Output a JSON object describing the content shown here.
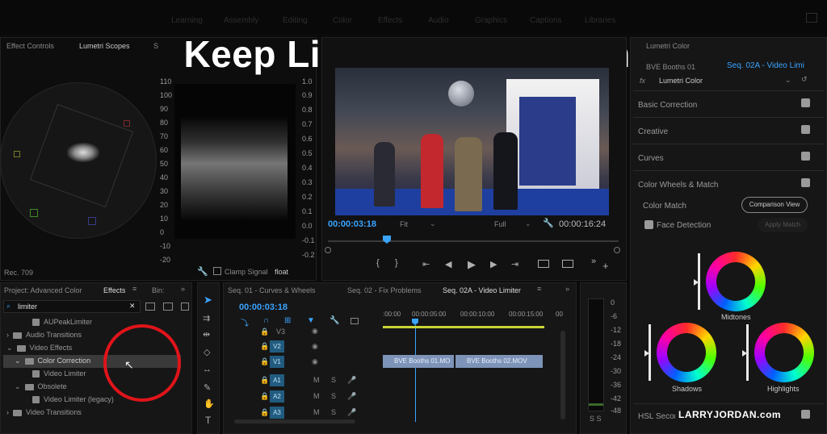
{
  "title": "Keep Lighting Consistent",
  "workspaces": [
    "Learning",
    "Assembly",
    "Editing",
    "Color",
    "Effects",
    "Audio",
    "Graphics",
    "Captions",
    "Libraries"
  ],
  "scopes": {
    "tabs": [
      "Effect Controls",
      "Lumetri Scopes",
      "S"
    ],
    "left_ticks": [
      "110",
      "100",
      "90",
      "80",
      "70",
      "60",
      "50",
      "40",
      "30",
      "20",
      "10",
      "0",
      "-10",
      "-20"
    ],
    "right_ticks": [
      "1.0",
      "0.9",
      "0.8",
      "0.7",
      "0.6",
      "0.5",
      "0.4",
      "0.3",
      "0.2",
      "0.1",
      "0.0",
      "-0.1",
      "-0.2"
    ],
    "rec": "Rec. 709",
    "clamp": "Clamp Signal",
    "float": "float"
  },
  "program": {
    "timecode": "00:00:03:18",
    "fit": "Fit",
    "full": "Full",
    "duration": "00:00:16:24"
  },
  "project": {
    "title": "Project: Advanced Color",
    "effects_tab": "Effects",
    "bin_tab": "Bin:",
    "search": "limiter",
    "items": [
      "AUPeakLimiter",
      "Audio Transitions",
      "Video Effects",
      "Color Correction",
      "Video Limiter",
      "Obsolete",
      "Video Limiter (legacy)",
      "Video Transitions"
    ]
  },
  "sequences": {
    "tabs": [
      "Seq. 01 - Curves & Wheels",
      "Seq. 02 - Fix Problems",
      "Seq. 02A - Video Limiter"
    ],
    "timecode": "00:00:03:18",
    "ruler": [
      ":00:00",
      "00:00:05:00",
      "00:00:10:00",
      "00:00:15:00",
      "00"
    ],
    "video_tracks": [
      "V3",
      "V2",
      "V1"
    ],
    "audio_tracks": [
      "A1",
      "A2",
      "A3"
    ],
    "clips": [
      "BVE Booths 01.MO",
      "BVE Booths 02.MOV"
    ]
  },
  "meter": {
    "ticks": [
      "0",
      "-6",
      "-12",
      "-18",
      "-24",
      "-30",
      "-36",
      "-42",
      "-48"
    ],
    "footer": "S S"
  },
  "lumetri": {
    "header": "Lumetri Color",
    "seq": "Seq. 02A - Video Limi",
    "clip": "BVE Booths 01",
    "fx": "Lumetri Color",
    "sections": [
      "Basic Correction",
      "Creative",
      "Curves",
      "Color Wheels & Match",
      "HSL Secondary"
    ],
    "color_match": "Color Match",
    "comparison": "Comparison View",
    "face_detection": "Face Detection",
    "apply": "Apply Match",
    "wheels": [
      "Midtones",
      "Shadows",
      "Highlights"
    ]
  },
  "watermark": "LARRYJORDAN.com"
}
